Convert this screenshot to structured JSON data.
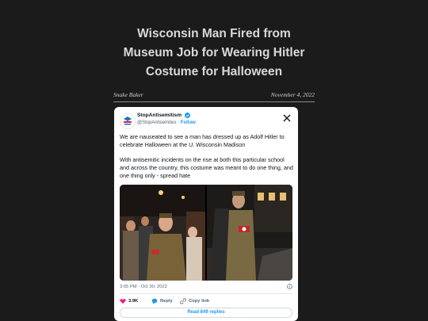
{
  "article": {
    "headline_lines": [
      "Wisconsin Man Fired from",
      "Museum Job for Wearing Hitler",
      "Costume for Halloween"
    ],
    "author": "Snake Baker",
    "date": "November 4, 2022"
  },
  "tweet": {
    "account_name": "StopAntisemitism",
    "handle": "@StopAntisemites",
    "separator": "·",
    "follow_label": "Follow",
    "paragraphs": [
      "We are nauseated to see a man has dressed up as Adolf Hitler to celebrate Halloween at the U. Wisconsin Madison",
      "With antisemitic incidents on the rise at both this particular school and across the country, this costume was meant to do one thing, and one thing only - spread hate"
    ],
    "timestamp": "3:05 PM · Oct 30, 2022",
    "likes": "3.9K",
    "reply_label": "Reply",
    "copy_link_label": "Copy link",
    "read_replies_label": "Read 849 replies",
    "icons": {
      "brand": "x-logo-icon",
      "verified": "verified-badge-icon",
      "info": "info-icon",
      "like": "heart-icon",
      "reply": "speech-bubble-icon",
      "copy": "link-icon"
    },
    "colors": {
      "accent": "#1d9bf0",
      "like": "#f91880",
      "text": "#0f1419",
      "muted": "#536471"
    }
  }
}
